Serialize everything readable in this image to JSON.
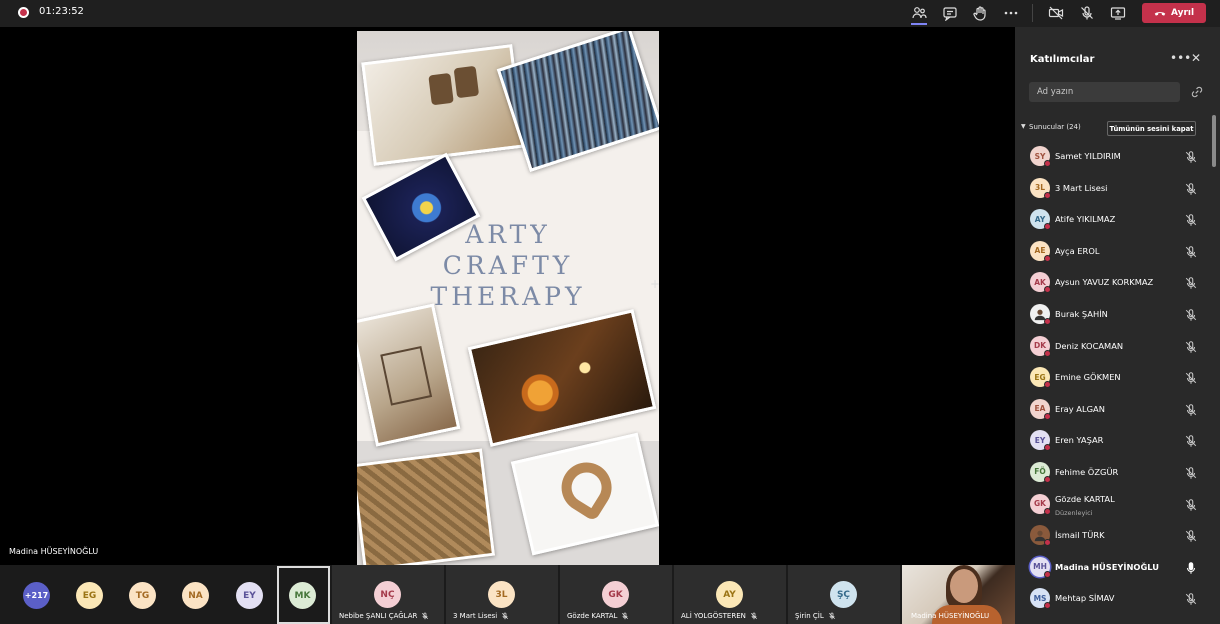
{
  "topbar": {
    "timer": "01:23:52",
    "leave_label": "Ayrıl"
  },
  "presenter": {
    "name": "Madina HÜSEYİNOĞLU"
  },
  "slide": {
    "title_lines": [
      "ARTY",
      "CRAFTY",
      "THERAPY"
    ]
  },
  "panel": {
    "title": "Katılımcılar",
    "search_placeholder": "Ad yazın",
    "section_label": "Sunucular (24)",
    "mute_all_label": "Tümünün sesini kapat",
    "participants": [
      {
        "initials": "SY",
        "name": "Samet YILDIRIM",
        "sub": "",
        "bg": "#f1d4ce",
        "fg": "#a0523f",
        "mic": "muted"
      },
      {
        "initials": "3L",
        "name": "3 Mart Lisesi",
        "sub": "",
        "bg": "#fbe3c4",
        "fg": "#a46a23",
        "mic": "muted"
      },
      {
        "initials": "AY",
        "name": "Atife YIKILMAZ",
        "sub": "",
        "bg": "#cfe3ee",
        "fg": "#356a8a",
        "mic": "muted"
      },
      {
        "initials": "AE",
        "name": "Ayça EROL",
        "sub": "",
        "bg": "#fbe3c4",
        "fg": "#a46a23",
        "mic": "muted"
      },
      {
        "initials": "AK",
        "name": "Aysun YAVUZ KORKMAZ",
        "sub": "",
        "bg": "#f4cfd4",
        "fg": "#a43a4a",
        "mic": "muted"
      },
      {
        "initials": "",
        "name": "Burak ŞAHİN",
        "sub": "",
        "bg": "#f0f0f0",
        "fg": "#333333",
        "mic": "muted"
      },
      {
        "initials": "DK",
        "name": "Deniz KOCAMAN",
        "sub": "",
        "bg": "#f4cfd4",
        "fg": "#a43a4a",
        "mic": "muted"
      },
      {
        "initials": "EG",
        "name": "Emine GÖKMEN",
        "sub": "",
        "bg": "#fbe7b6",
        "fg": "#9b7414",
        "mic": "muted"
      },
      {
        "initials": "EA",
        "name": "Eray ALGAN",
        "sub": "",
        "bg": "#f1d4ce",
        "fg": "#a0523f",
        "mic": "muted"
      },
      {
        "initials": "EY",
        "name": "Eren YAŞAR",
        "sub": "",
        "bg": "#e3e0f3",
        "fg": "#5a5298",
        "mic": "muted"
      },
      {
        "initials": "FÖ",
        "name": "Fehime ÖZGÜR",
        "sub": "",
        "bg": "#dcebd5",
        "fg": "#47773b",
        "mic": "muted"
      },
      {
        "initials": "GK",
        "name": "Gözde KARTAL",
        "sub": "Düzenleyici",
        "bg": "#f4cfd4",
        "fg": "#a43a4a",
        "mic": "muted"
      },
      {
        "initials": "",
        "name": "İsmail TÜRK",
        "sub": "",
        "bg": "#8a5a3c",
        "fg": "#ffffff",
        "mic": "muted"
      },
      {
        "initials": "MH",
        "name": "Madina HÜSEYİNOĞLU",
        "sub": "",
        "bg": "#e3e0f3",
        "fg": "#5a5298",
        "mic": "on"
      },
      {
        "initials": "MS",
        "name": "Mehtap SİMAV",
        "sub": "",
        "bg": "#d7e2f5",
        "fg": "#3f5f9c",
        "mic": "muted"
      }
    ]
  },
  "gallery": {
    "more_count": "+217",
    "circles": [
      {
        "initials": "EG",
        "bg": "#fbe7b6",
        "fg": "#9b7414"
      },
      {
        "initials": "TG",
        "bg": "#fbe3c4",
        "fg": "#a46a23"
      },
      {
        "initials": "NA",
        "bg": "#fbe3c4",
        "fg": "#a46a23"
      },
      {
        "initials": "EY",
        "bg": "#e3e0f3",
        "fg": "#5a5298"
      },
      {
        "initials": "MK",
        "bg": "#dcebd5",
        "fg": "#47773b"
      }
    ],
    "tiles": [
      {
        "initials": "NÇ",
        "name": "Nebibe ŞANLI ÇAĞLAR",
        "bg": "#f4cfd4",
        "fg": "#a43a4a"
      },
      {
        "initials": "3L",
        "name": "3 Mart Lisesi",
        "bg": "#fbe3c4",
        "fg": "#a46a23"
      },
      {
        "initials": "GK",
        "name": "Gözde KARTAL",
        "bg": "#f4cfd4",
        "fg": "#a43a4a"
      },
      {
        "initials": "AY",
        "name": "ALİ YOLGÖSTEREN",
        "bg": "#fbe7b6",
        "fg": "#9b7414"
      },
      {
        "initials": "ŞÇ",
        "name": "Şirin ÇİL",
        "bg": "#cfe3ee",
        "fg": "#356a8a"
      }
    ],
    "video_name": "Madina HÜSEYİNOĞLU"
  },
  "colors": {
    "accent": "#5b5fc7",
    "leave": "#c4314b",
    "panel_bg": "#292929"
  }
}
